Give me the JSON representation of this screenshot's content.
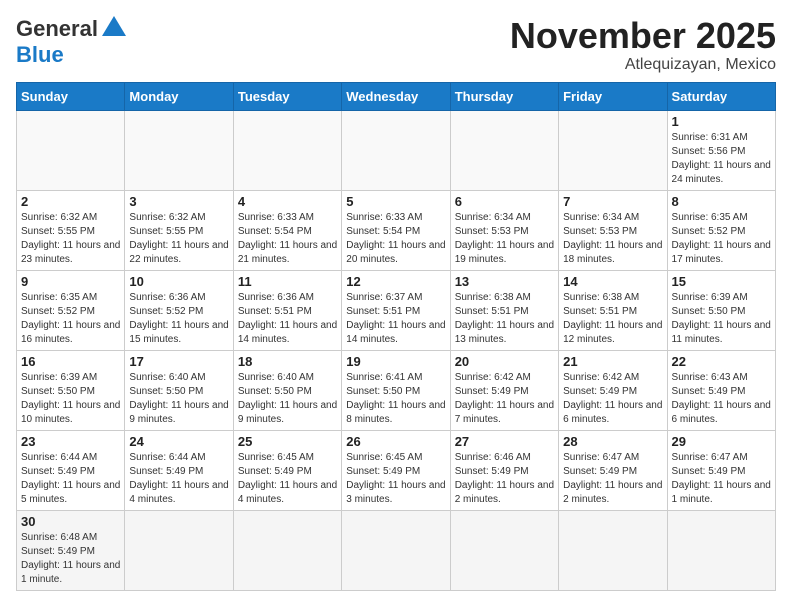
{
  "header": {
    "logo_general": "General",
    "logo_blue": "Blue",
    "month_title": "November 2025",
    "location": "Atlequizayan, Mexico"
  },
  "weekdays": [
    "Sunday",
    "Monday",
    "Tuesday",
    "Wednesday",
    "Thursday",
    "Friday",
    "Saturday"
  ],
  "weeks": [
    [
      {
        "day": "",
        "info": ""
      },
      {
        "day": "",
        "info": ""
      },
      {
        "day": "",
        "info": ""
      },
      {
        "day": "",
        "info": ""
      },
      {
        "day": "",
        "info": ""
      },
      {
        "day": "",
        "info": ""
      },
      {
        "day": "1",
        "info": "Sunrise: 6:31 AM\nSunset: 5:56 PM\nDaylight: 11 hours and 24 minutes."
      }
    ],
    [
      {
        "day": "2",
        "info": "Sunrise: 6:32 AM\nSunset: 5:55 PM\nDaylight: 11 hours and 23 minutes."
      },
      {
        "day": "3",
        "info": "Sunrise: 6:32 AM\nSunset: 5:55 PM\nDaylight: 11 hours and 22 minutes."
      },
      {
        "day": "4",
        "info": "Sunrise: 6:33 AM\nSunset: 5:54 PM\nDaylight: 11 hours and 21 minutes."
      },
      {
        "day": "5",
        "info": "Sunrise: 6:33 AM\nSunset: 5:54 PM\nDaylight: 11 hours and 20 minutes."
      },
      {
        "day": "6",
        "info": "Sunrise: 6:34 AM\nSunset: 5:53 PM\nDaylight: 11 hours and 19 minutes."
      },
      {
        "day": "7",
        "info": "Sunrise: 6:34 AM\nSunset: 5:53 PM\nDaylight: 11 hours and 18 minutes."
      },
      {
        "day": "8",
        "info": "Sunrise: 6:35 AM\nSunset: 5:52 PM\nDaylight: 11 hours and 17 minutes."
      }
    ],
    [
      {
        "day": "9",
        "info": "Sunrise: 6:35 AM\nSunset: 5:52 PM\nDaylight: 11 hours and 16 minutes."
      },
      {
        "day": "10",
        "info": "Sunrise: 6:36 AM\nSunset: 5:52 PM\nDaylight: 11 hours and 15 minutes."
      },
      {
        "day": "11",
        "info": "Sunrise: 6:36 AM\nSunset: 5:51 PM\nDaylight: 11 hours and 14 minutes."
      },
      {
        "day": "12",
        "info": "Sunrise: 6:37 AM\nSunset: 5:51 PM\nDaylight: 11 hours and 14 minutes."
      },
      {
        "day": "13",
        "info": "Sunrise: 6:38 AM\nSunset: 5:51 PM\nDaylight: 11 hours and 13 minutes."
      },
      {
        "day": "14",
        "info": "Sunrise: 6:38 AM\nSunset: 5:51 PM\nDaylight: 11 hours and 12 minutes."
      },
      {
        "day": "15",
        "info": "Sunrise: 6:39 AM\nSunset: 5:50 PM\nDaylight: 11 hours and 11 minutes."
      }
    ],
    [
      {
        "day": "16",
        "info": "Sunrise: 6:39 AM\nSunset: 5:50 PM\nDaylight: 11 hours and 10 minutes."
      },
      {
        "day": "17",
        "info": "Sunrise: 6:40 AM\nSunset: 5:50 PM\nDaylight: 11 hours and 9 minutes."
      },
      {
        "day": "18",
        "info": "Sunrise: 6:40 AM\nSunset: 5:50 PM\nDaylight: 11 hours and 9 minutes."
      },
      {
        "day": "19",
        "info": "Sunrise: 6:41 AM\nSunset: 5:50 PM\nDaylight: 11 hours and 8 minutes."
      },
      {
        "day": "20",
        "info": "Sunrise: 6:42 AM\nSunset: 5:49 PM\nDaylight: 11 hours and 7 minutes."
      },
      {
        "day": "21",
        "info": "Sunrise: 6:42 AM\nSunset: 5:49 PM\nDaylight: 11 hours and 6 minutes."
      },
      {
        "day": "22",
        "info": "Sunrise: 6:43 AM\nSunset: 5:49 PM\nDaylight: 11 hours and 6 minutes."
      }
    ],
    [
      {
        "day": "23",
        "info": "Sunrise: 6:44 AM\nSunset: 5:49 PM\nDaylight: 11 hours and 5 minutes."
      },
      {
        "day": "24",
        "info": "Sunrise: 6:44 AM\nSunset: 5:49 PM\nDaylight: 11 hours and 4 minutes."
      },
      {
        "day": "25",
        "info": "Sunrise: 6:45 AM\nSunset: 5:49 PM\nDaylight: 11 hours and 4 minutes."
      },
      {
        "day": "26",
        "info": "Sunrise: 6:45 AM\nSunset: 5:49 PM\nDaylight: 11 hours and 3 minutes."
      },
      {
        "day": "27",
        "info": "Sunrise: 6:46 AM\nSunset: 5:49 PM\nDaylight: 11 hours and 2 minutes."
      },
      {
        "day": "28",
        "info": "Sunrise: 6:47 AM\nSunset: 5:49 PM\nDaylight: 11 hours and 2 minutes."
      },
      {
        "day": "29",
        "info": "Sunrise: 6:47 AM\nSunset: 5:49 PM\nDaylight: 11 hours and 1 minute."
      }
    ],
    [
      {
        "day": "30",
        "info": "Sunrise: 6:48 AM\nSunset: 5:49 PM\nDaylight: 11 hours and 1 minute."
      },
      {
        "day": "",
        "info": ""
      },
      {
        "day": "",
        "info": ""
      },
      {
        "day": "",
        "info": ""
      },
      {
        "day": "",
        "info": ""
      },
      {
        "day": "",
        "info": ""
      },
      {
        "day": "",
        "info": ""
      }
    ]
  ]
}
